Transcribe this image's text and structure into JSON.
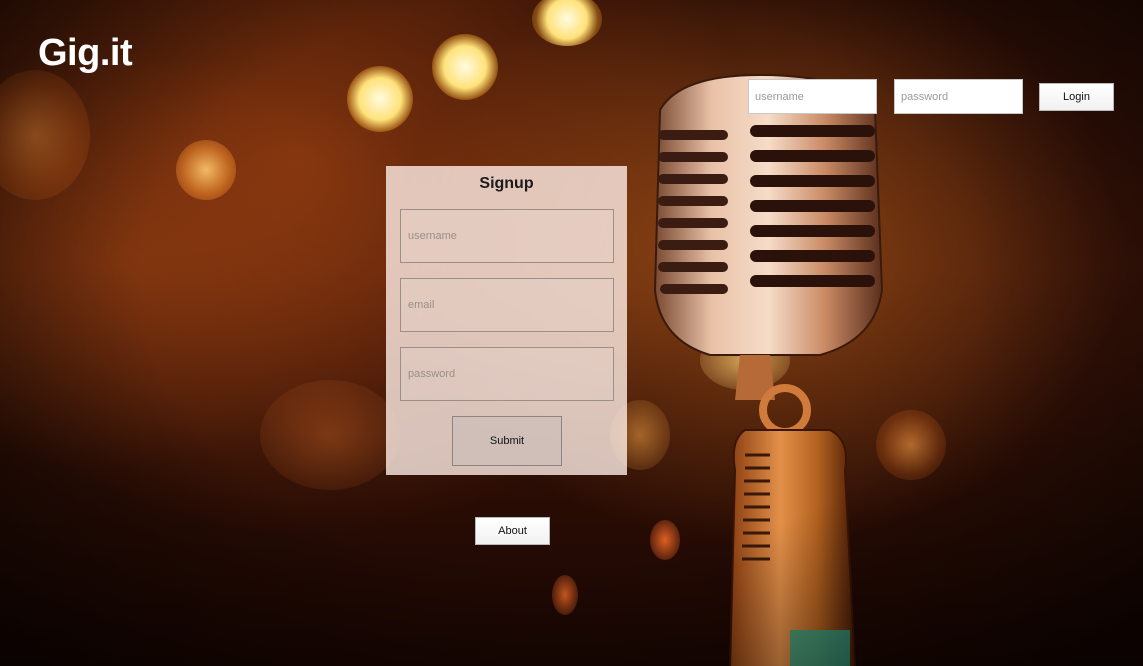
{
  "brand": {
    "logo_text": "Gig.it"
  },
  "login": {
    "username_placeholder": "username",
    "password_placeholder": "password",
    "button_label": "Login"
  },
  "signup": {
    "title": "Signup",
    "username_placeholder": "username",
    "email_placeholder": "email",
    "password_placeholder": "password",
    "submit_label": "Submit"
  },
  "footer": {
    "about_label": "About"
  },
  "background": {
    "image": "stage-microphone-bokeh",
    "colors": {
      "primary_glow": "#ff9a3c",
      "dark": "#1a0602"
    }
  }
}
